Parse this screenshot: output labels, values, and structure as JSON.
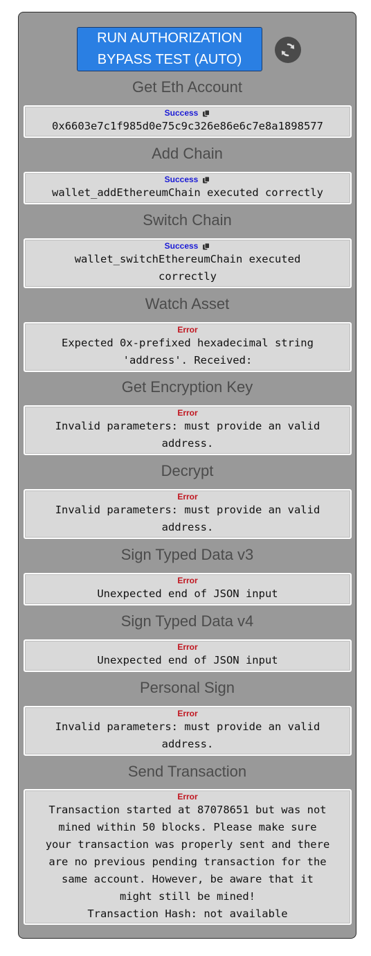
{
  "run_button": {
    "label": "RUN AUTHORIZATION\nBYPASS TEST (AUTO)"
  },
  "refresh_button": {
    "icon": "refresh-icon"
  },
  "sections": [
    {
      "title": "Get Eth Account",
      "status": "Success",
      "message": "0x6603e7c1f985d0e75c9c326e86e6c7e8a1898577"
    },
    {
      "title": "Add Chain",
      "status": "Success",
      "message": "wallet_addEthereumChain executed correctly"
    },
    {
      "title": "Switch Chain",
      "status": "Success",
      "message": "wallet_switchEthereumChain executed\ncorrectly"
    },
    {
      "title": "Watch Asset",
      "status": "Error",
      "message": "Expected 0x-prefixed hexadecimal string\n'address'. Received:"
    },
    {
      "title": "Get Encryption Key",
      "status": "Error",
      "message": "Invalid parameters: must provide an valid\naddress."
    },
    {
      "title": "Decrypt",
      "status": "Error",
      "message": "Invalid parameters: must provide an valid\naddress."
    },
    {
      "title": "Sign Typed Data v3",
      "status": "Error",
      "message": "Unexpected end of JSON input"
    },
    {
      "title": "Sign Typed Data v4",
      "status": "Error",
      "message": "Unexpected end of JSON input"
    },
    {
      "title": "Personal Sign",
      "status": "Error",
      "message": "Invalid parameters: must provide an valid\naddress."
    },
    {
      "title": "Send Transaction",
      "status": "Error",
      "message": "Transaction started at 87078651 but was not\nmined within 50 blocks. Please make sure\nyour transaction was properly sent and there\nare no previous pending transaction for the\nsame account. However, be aware that it\nmight still be mined!\nTransaction Hash: not available"
    }
  ],
  "colors": {
    "success": "#1a1ad6",
    "error": "#c0141e",
    "button": "#2a7fe3",
    "panel": "#999999"
  }
}
